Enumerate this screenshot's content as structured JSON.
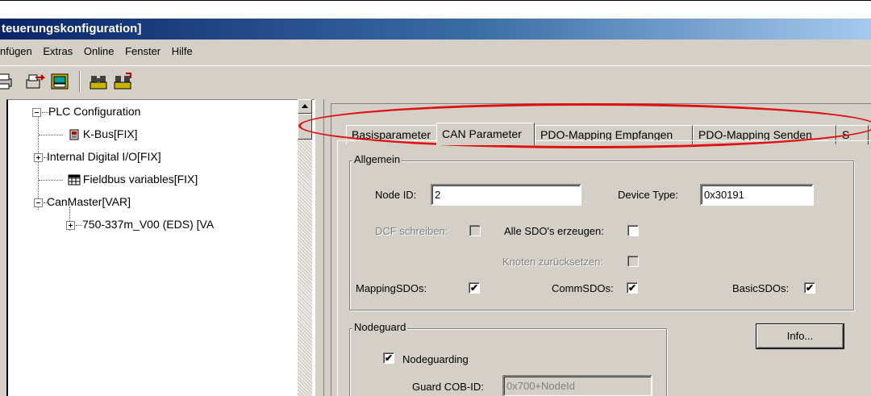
{
  "window": {
    "title": "teuerungskonfiguration]"
  },
  "menu": [
    "nfügen",
    "Extras",
    "Online",
    "Fenster",
    "Hilfe"
  ],
  "toolbar": {
    "icons": [
      "print-icon",
      "export-icon",
      "library-icon",
      "find-icon",
      "find-next-icon"
    ]
  },
  "tree": {
    "root": "PLC Configuration",
    "items": [
      {
        "label": "K-Bus[FIX]",
        "icon": "bus-icon"
      },
      {
        "label": "Internal Digital I/O[FIX]"
      },
      {
        "label": "Fieldbus variables[FIX]",
        "icon": "grid-icon"
      },
      {
        "label": "CanMaster[VAR]"
      },
      {
        "label": "750-337m_V00 (EDS)  [VA"
      }
    ]
  },
  "tabs": [
    "Basisparameter",
    "CAN Parameter",
    "PDO-Mapping Empfangen",
    "PDO-Mapping Senden",
    "S"
  ],
  "allgemein": {
    "title": "Allgemein",
    "node_id_label": "Node ID:",
    "node_id_value": "2",
    "device_type_label": "Device Type:",
    "device_type_value": "0x30191",
    "dcf_label": "DCF schreiben:",
    "alle_sdo_label": "Alle SDO's erzeugen:",
    "knoten_label": "Knoten zurücksetzen:",
    "mapping_label": "MappingSDOs:",
    "comm_label": "CommSDOs:",
    "basic_label": "BasicSDOs:",
    "check_mark": "✔"
  },
  "nodeguard": {
    "title": "Nodeguard",
    "nodeguarding_label": "Nodeguarding",
    "guard_cob_label": "Guard COB-ID:",
    "guard_cob_value": "0x700+NodeId"
  },
  "info_button": "Info..."
}
